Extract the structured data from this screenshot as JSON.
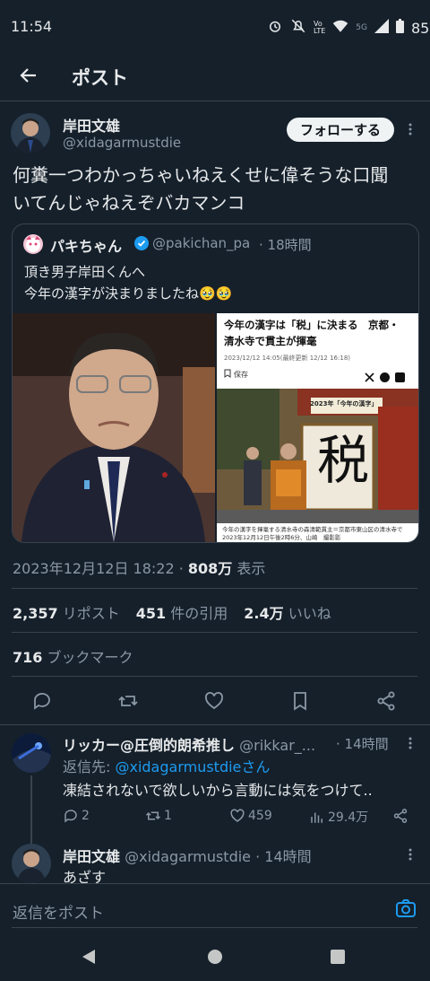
{
  "status_bar": {
    "time": "11:54",
    "net1": "Vo​LTE",
    "net2": "5G",
    "battery": "85%"
  },
  "header": {
    "title": "ポスト"
  },
  "post": {
    "name": "岸田文雄",
    "handle": "@xidagarmustdie",
    "follow_label": "フォローする",
    "text_line1": "何糞一つわかっちゃいねえくせに偉そうな口聞",
    "text_line2": "いてんじゃねえぞバカマンコ",
    "quote": {
      "name": "パキちゃん",
      "handle": "@pakichan_pa",
      "time": "· 18時間",
      "text_line1": "頂き男子岸田くんへ",
      "text_line2": "今年の漢字が決まりましたね🥹🥹",
      "article": {
        "headline_line1": "今年の漢字は「税」に決まる　京都・",
        "headline_line2": "清水寺で貫主が揮毫",
        "date": "2023/12/12 14:05(最終更新 12/12 16:18)",
        "save": "保存",
        "board_label": "2023年「今年の漢字」",
        "kanji": "税",
        "caption": "今年の漢字を揮毫する清水寺の森清範貫主＝京都市東山区の清水寺で",
        "caption2": "2023年12月12日午後2時6分、山崎　撮影影"
      }
    },
    "timestamp": "2023年12月12日 18:22 · ",
    "views_count": "808万",
    "views_label": " 表示",
    "stats": {
      "reposts_count": "2,357",
      "reposts_label": "リポスト",
      "quotes_count": "451",
      "quotes_label": "件の引用",
      "likes_count": "2.4万",
      "likes_label": "いいね",
      "bookmarks_count": "716",
      "bookmarks_label": "ブックマーク"
    }
  },
  "replies": [
    {
      "name": "リッカー@圧倒的朗希推し",
      "handle": "@rikkar_...",
      "time": "· 14時間",
      "reply_to_prefix": "返信先: ",
      "reply_to_handle": "@xidagarmustdieさん",
      "text": "凍結されないで欲しいから言動には気をつけて..",
      "replies": "2",
      "reposts": "1",
      "likes": "459",
      "views": "29.4万"
    },
    {
      "name": "岸田文雄",
      "handle": "@xidagarmustdie",
      "time": "· 14時間",
      "text": "あざす"
    }
  ],
  "reply_bar": {
    "placeholder": "返信をポスト"
  },
  "colors": {
    "bg": "#15202b",
    "accent": "#1d9bf0",
    "muted": "#8b98a5",
    "divider": "#38444d"
  }
}
